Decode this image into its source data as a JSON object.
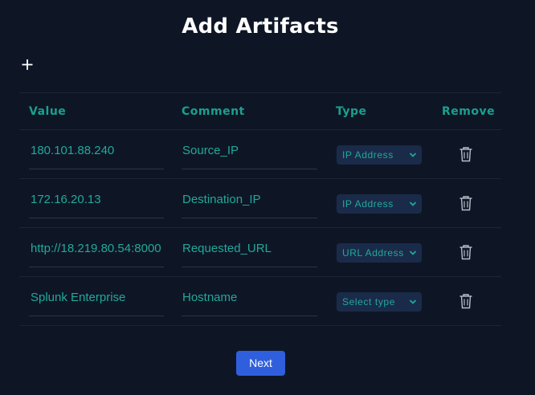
{
  "page": {
    "title": "Add Artifacts"
  },
  "toolbar": {
    "add_icon": "plus-icon"
  },
  "table": {
    "headers": {
      "value": "Value",
      "comment": "Comment",
      "type": "Type",
      "remove": "Remove"
    },
    "rows": [
      {
        "value": "180.101.88.240",
        "comment": "Source_IP",
        "type": "IP Address"
      },
      {
        "value": "172.16.20.13",
        "comment": "Destination_IP",
        "type": "IP Address"
      },
      {
        "value": "http://18.219.80.54:8000",
        "comment": "Requested_URL",
        "type": "URL Address"
      },
      {
        "value": "Splunk Enterprise",
        "comment": "Hostname",
        "type": "Select type"
      }
    ],
    "remove_icon": "trash-icon"
  },
  "footer": {
    "next_label": "Next"
  },
  "colors": {
    "background": "#0e1626",
    "accent_text": "#22a89a",
    "header_text": "#19a08e",
    "select_bg": "#1a2b4a",
    "primary_button": "#2f5fdc"
  }
}
